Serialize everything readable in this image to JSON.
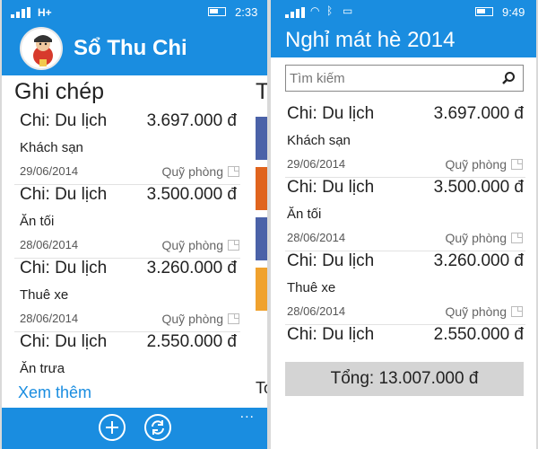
{
  "left": {
    "status": {
      "network": "H+",
      "time": "2:33"
    },
    "app_title": "Sổ Thu Chi",
    "pivot_current": "Ghi chép",
    "pivot_next_peek": "Tà",
    "next_peek_bottom": "To",
    "entries": [
      {
        "category": "Chi: Du lịch",
        "amount": "3.697.000 đ",
        "note": "Khách sạn",
        "date": "29/06/2014",
        "fund": "Quỹ phòng"
      },
      {
        "category": "Chi: Du lịch",
        "amount": "3.500.000 đ",
        "note": "Ăn tối",
        "date": "28/06/2014",
        "fund": "Quỹ phòng"
      },
      {
        "category": "Chi: Du lịch",
        "amount": "3.260.000 đ",
        "note": "Thuê xe",
        "date": "28/06/2014",
        "fund": "Quỹ phòng"
      },
      {
        "category": "Chi: Du lịch",
        "amount": "2.550.000 đ",
        "note": "Ăn trưa"
      }
    ],
    "see_more": "Xem thêm",
    "appbar": {
      "more": "..."
    }
  },
  "right": {
    "status": {
      "time": "9:49"
    },
    "title": "Nghỉ mát hè 2014",
    "search": {
      "placeholder": "Tìm kiếm"
    },
    "entries": [
      {
        "category": "Chi: Du lịch",
        "amount": "3.697.000 đ",
        "note": "Khách sạn",
        "date": "29/06/2014",
        "fund": "Quỹ phòng"
      },
      {
        "category": "Chi: Du lịch",
        "amount": "3.500.000 đ",
        "note": "Ăn tối",
        "date": "28/06/2014",
        "fund": "Quỹ phòng"
      },
      {
        "category": "Chi: Du lịch",
        "amount": "3.260.000 đ",
        "note": "Thuê xe",
        "date": "28/06/2014",
        "fund": "Quỹ phòng"
      },
      {
        "category": "Chi: Du lịch",
        "amount": "2.550.000 đ"
      }
    ],
    "total": "Tổng: 13.007.000 đ"
  },
  "colors": {
    "accent": "#1a8de0",
    "total_bg": "#d4d4d4"
  },
  "icons": [
    "signal-icon",
    "battery-icon",
    "search-icon",
    "add-icon",
    "sync-icon",
    "fund-icon"
  ]
}
